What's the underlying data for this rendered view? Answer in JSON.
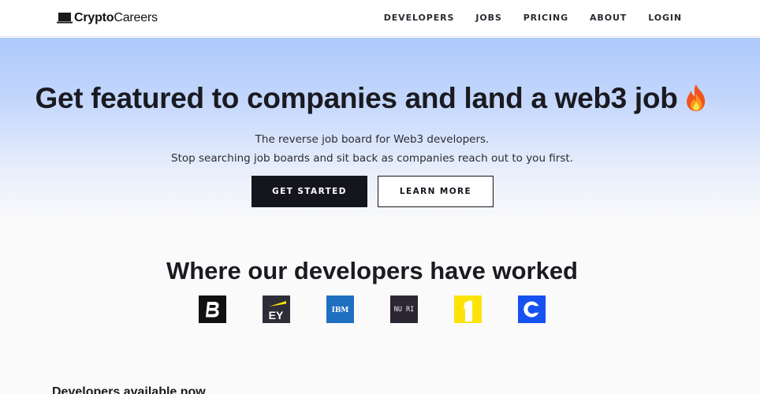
{
  "brand": {
    "name_bold": "Crypto",
    "name_light": "Careers"
  },
  "nav": {
    "items": [
      {
        "label": "DEVELOPERS"
      },
      {
        "label": "JOBS"
      },
      {
        "label": "PRICING"
      },
      {
        "label": "ABOUT"
      },
      {
        "label": "LOGIN"
      }
    ]
  },
  "hero": {
    "title": "Get featured to companies and land a web3 job",
    "emoji_icon": "fire-icon",
    "tagline_1": "The reverse job board for Web3 developers.",
    "tagline_2": "Stop searching job boards and sit back as companies reach out to you first.",
    "primary_cta": "GET STARTED",
    "secondary_cta": "LEARN MORE",
    "gradient_top": "#adc9fb"
  },
  "companies": {
    "title": "Where our developers have worked",
    "logos": [
      {
        "icon": "bitwise-b-logo-icon",
        "color": "#111111"
      },
      {
        "icon": "ey-logo-icon",
        "text": "EY",
        "color": "#2e2e38"
      },
      {
        "icon": "ibm-logo-icon",
        "text": "IBM",
        "color": "#1f70c1"
      },
      {
        "icon": "nuri-logo-icon",
        "text": "NU RI",
        "color": "#2c2533"
      },
      {
        "icon": "one-logo-icon",
        "color": "#fbe30a"
      },
      {
        "icon": "coinbase-logo-icon",
        "color": "#1652f0"
      }
    ]
  },
  "developers_section": {
    "title": "Developers available now"
  }
}
